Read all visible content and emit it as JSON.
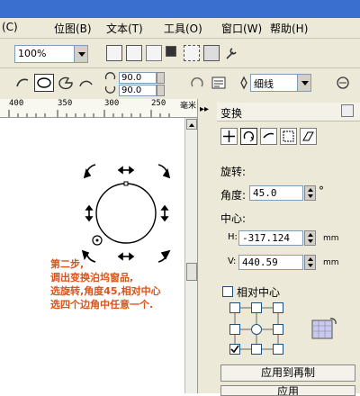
{
  "menu": {
    "items": [
      {
        "label": "(C)"
      },
      {
        "label": "位图(B)"
      },
      {
        "label": "文本(T)"
      },
      {
        "label": "工具(O)"
      },
      {
        "label": "窗口(W)"
      },
      {
        "label": "帮助(H)"
      }
    ]
  },
  "toolbar": {
    "zoom_value": "100%"
  },
  "property_bar": {
    "rotation_x": "90.0",
    "rotation_y": "90.0",
    "line_style": "细线"
  },
  "ruler": {
    "ticks": [
      "400",
      "350",
      "300",
      "250"
    ],
    "unit": "毫米"
  },
  "annotation": {
    "lines": [
      "第二步,",
      "调出变换泊坞窗品,",
      "选旋转,角度45,相对中心",
      "选四个边角中任意一个."
    ]
  },
  "panel": {
    "title": "变换",
    "section_rotation": "旋转:",
    "angle_label": "角度:",
    "angle_value": "45.0",
    "angle_unit": "°",
    "center_label": "中心:",
    "h_label": "H:",
    "h_value": "-317.124",
    "v_label": "V:",
    "v_value": "440.59",
    "unit": "mm",
    "relative_center_label": "相对中心",
    "apply_copy_button": "应用到再制",
    "apply_button": "应用"
  },
  "colors": {
    "annotation": "#d8541c",
    "chrome": "#ece9d8",
    "titlebar": "#3a6fd0"
  }
}
